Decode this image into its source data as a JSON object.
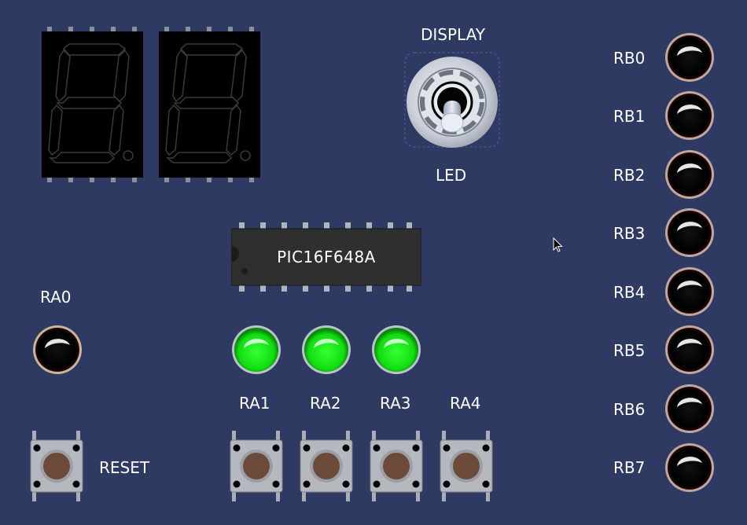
{
  "seven_segment": {
    "digits": [
      "",
      ""
    ]
  },
  "toggle": {
    "top_label": "DISPLAY",
    "bottom_label": "LED",
    "state": "DISPLAY"
  },
  "chip": {
    "label": "PIC16F648A"
  },
  "ra_leds": {
    "ra0": {
      "label": "RA0",
      "lit": false
    },
    "ra1": {
      "lit": true
    },
    "ra2": {
      "lit": true
    },
    "ra3": {
      "lit": true
    }
  },
  "buttons": {
    "reset_label": "RESET",
    "ra1_label": "RA1",
    "ra2_label": "RA2",
    "ra3_label": "RA3",
    "ra4_label": "RA4"
  },
  "rb_leds": [
    {
      "label": "RB0",
      "lit": false
    },
    {
      "label": "RB1",
      "lit": false
    },
    {
      "label": "RB2",
      "lit": false
    },
    {
      "label": "RB3",
      "lit": false
    },
    {
      "label": "RB4",
      "lit": false
    },
    {
      "label": "RB5",
      "lit": false
    },
    {
      "label": "RB6",
      "lit": false
    },
    {
      "label": "RB7",
      "lit": false
    }
  ],
  "colors": {
    "background": "#2e3a62",
    "led_on": "#22ee22",
    "led_off": "#050505",
    "button_cap": "#6b4a3a"
  }
}
